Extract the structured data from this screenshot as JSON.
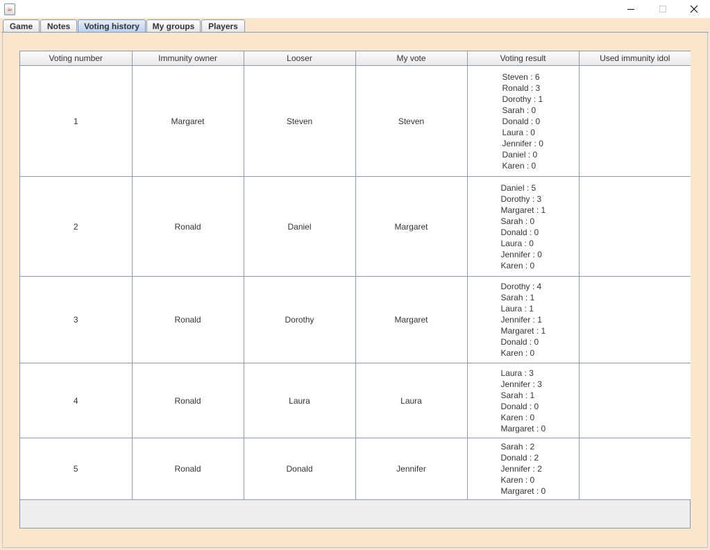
{
  "window": {
    "icon": "java-coffee-cup-icon",
    "controls": [
      "minimize-icon",
      "maximize-icon",
      "close-icon"
    ]
  },
  "tabs": [
    {
      "label": "Game",
      "selected": false
    },
    {
      "label": "Notes",
      "selected": false
    },
    {
      "label": "Voting history",
      "selected": true
    },
    {
      "label": "My groups",
      "selected": false
    },
    {
      "label": "Players",
      "selected": false
    }
  ],
  "table": {
    "columns": [
      "Voting number",
      "Immunity owner",
      "Looser",
      "My vote",
      "Voting result",
      "Used immunity idol"
    ],
    "rows": [
      {
        "number": "1",
        "immunity_owner": "Margaret",
        "looser": "Steven",
        "my_vote": "Steven",
        "results": [
          "Steven : 6",
          "Ronald : 3",
          "Dorothy : 1",
          "Sarah : 0",
          "Donald : 0",
          "Laura : 0",
          "Jennifer : 0",
          "Daniel : 0",
          "Karen : 0"
        ],
        "used_idol": ""
      },
      {
        "number": "2",
        "immunity_owner": "Ronald",
        "looser": "Daniel",
        "my_vote": "Margaret",
        "results": [
          "Daniel : 5",
          "Dorothy : 3",
          "Margaret : 1",
          "Sarah : 0",
          "Donald : 0",
          "Laura : 0",
          "Jennifer : 0",
          "Karen : 0"
        ],
        "used_idol": ""
      },
      {
        "number": "3",
        "immunity_owner": "Ronald",
        "looser": "Dorothy",
        "my_vote": "Margaret",
        "results": [
          "Dorothy : 4",
          "Sarah : 1",
          "Laura : 1",
          "Jennifer : 1",
          "Margaret : 1",
          "Donald : 0",
          "Karen : 0"
        ],
        "used_idol": ""
      },
      {
        "number": "4",
        "immunity_owner": "Ronald",
        "looser": "Laura",
        "my_vote": "Laura",
        "results": [
          "Laura : 3",
          "Jennifer : 3",
          "Sarah : 1",
          "Donald : 0",
          "Karen : 0",
          "Margaret : 0"
        ],
        "used_idol": ""
      },
      {
        "number": "5",
        "immunity_owner": "Ronald",
        "looser": "Donald",
        "my_vote": "Jennifer",
        "results": [
          "Sarah : 2",
          "Donald : 2",
          "Jennifer : 2",
          "Karen : 0",
          "Margaret : 0"
        ],
        "used_idol": ""
      }
    ]
  },
  "colors": {
    "window_background": "#fbe6cd",
    "grid_line": "#8a98b0",
    "selected_tab": "#b9cfee",
    "empty_viewport": "#eeeeee"
  }
}
